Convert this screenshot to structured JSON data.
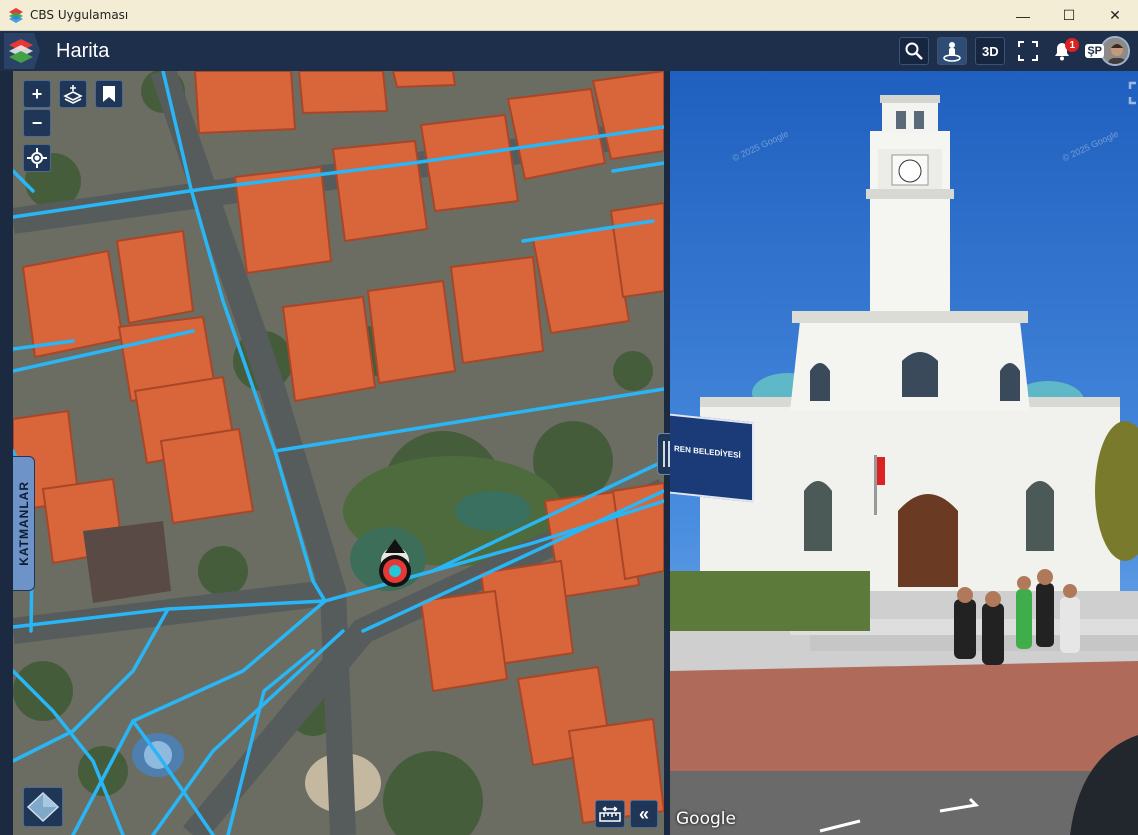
{
  "window": {
    "title": "CBS Uygulaması",
    "controls": [
      "—",
      "☐",
      "✕"
    ]
  },
  "app": {
    "title": "Harita"
  },
  "header_tools": {
    "three_d_label": "3D",
    "notification_count": "1",
    "user_initials": "ŞP"
  },
  "map": {
    "zoom_in": "+",
    "zoom_out": "−",
    "layers_tab_label": "KATMANLAR",
    "collapse_label": "«"
  },
  "street_view": {
    "attribution": "Google",
    "watermark": "© 2025 Google",
    "sign_text": "REN BELEDİYESİ"
  },
  "colors": {
    "titlebar": "#f3edd6",
    "header": "#1d2f4a",
    "road_lines": "#29b6f6",
    "roofs": "#d8663a",
    "marker": "#e53935"
  }
}
